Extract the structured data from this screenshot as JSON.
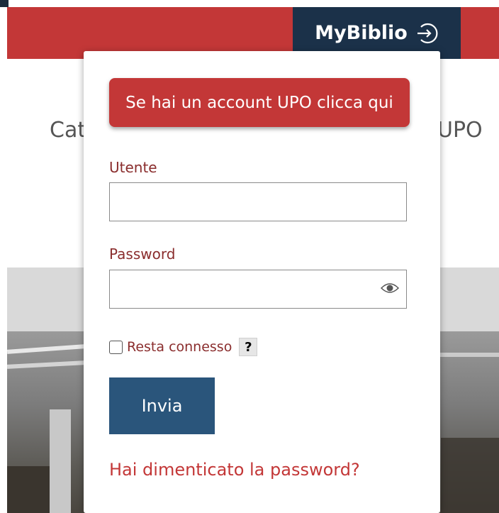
{
  "header": {
    "mybiblio_label": "MyBiblio",
    "login_icon": "sign-in-icon",
    "bg_text_left": "Cat",
    "bg_text_right": "UPO"
  },
  "login": {
    "upo_button_label": "Se hai un account UPO clicca qui",
    "username_label": "Utente",
    "username_value": "",
    "password_label": "Password",
    "password_value": "",
    "show_password_icon": "eye-icon",
    "remember_label": "Resta connesso",
    "remember_checked": false,
    "help_label": "?",
    "submit_label": "Invia",
    "forgot_link": "Hai dimenticato la password?"
  },
  "colors": {
    "brand_red": "#c33737",
    "navy": "#1b3149",
    "submit_blue": "#2a557b",
    "label_red": "#8a2d2d"
  }
}
